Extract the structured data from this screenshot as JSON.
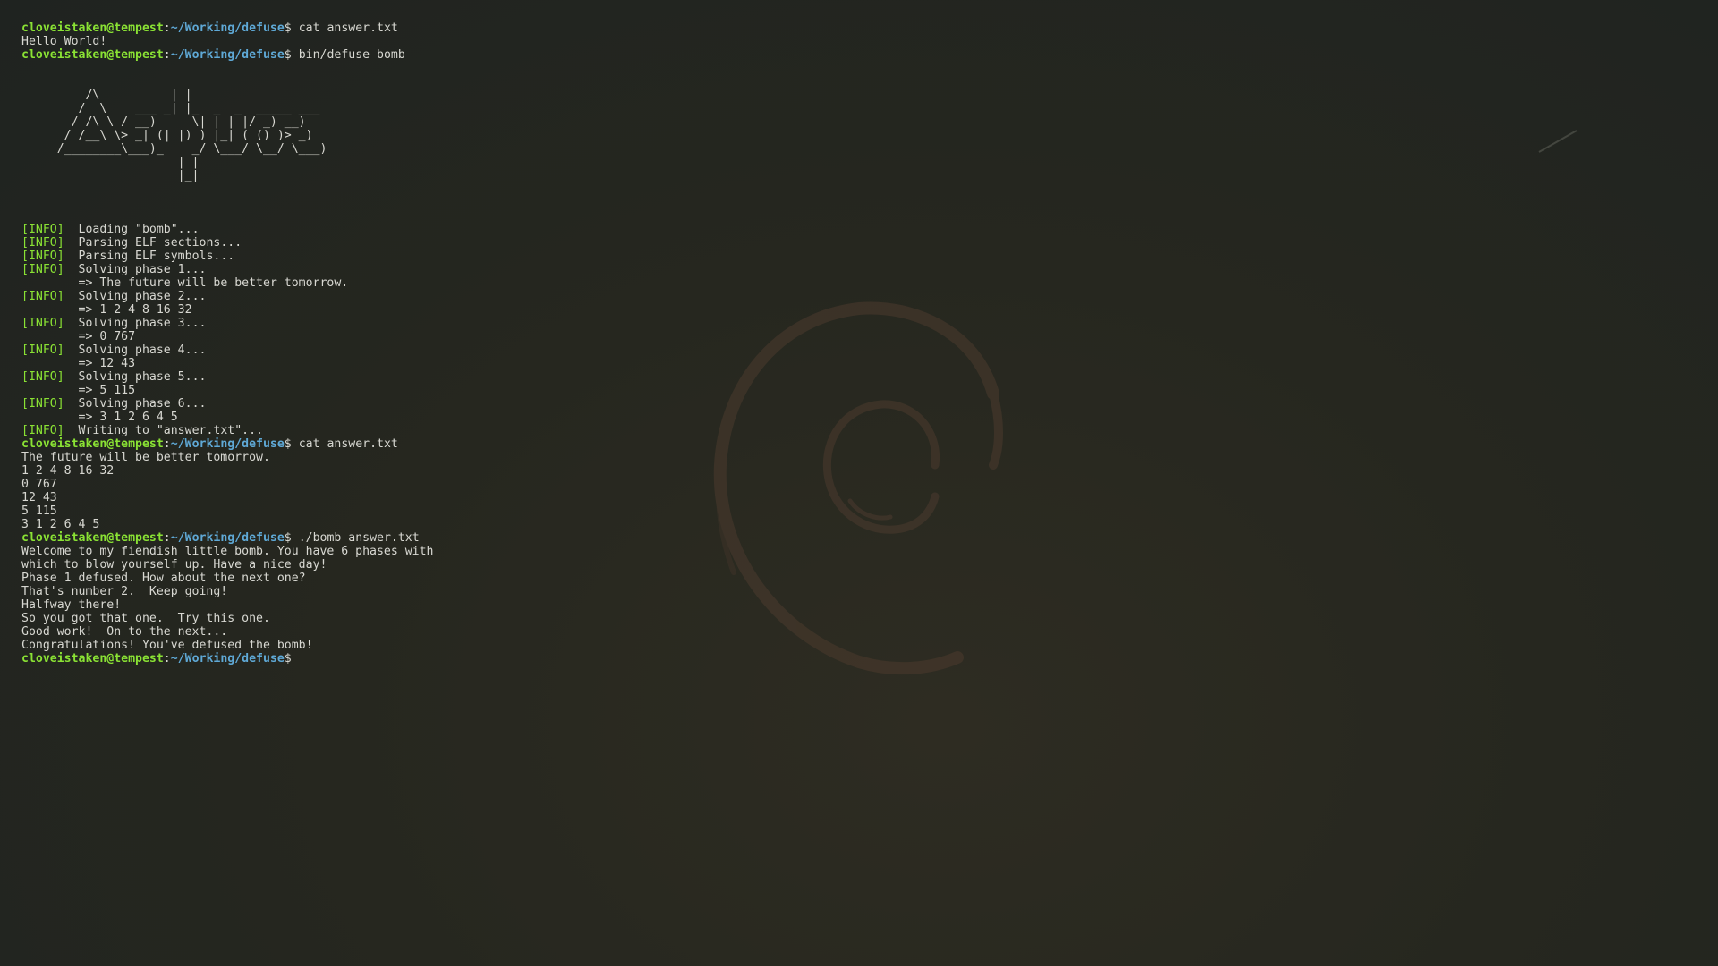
{
  "terminal": {
    "prompt": {
      "user_host": "cloveistaken@tempest",
      "colon": ":",
      "cwd": "~/Working/defuse",
      "symbol": "$"
    },
    "session": {
      "cmd1": "cat answer.txt",
      "cmd1_output": "Hello World!",
      "cmd2": "bin/defuse bomb",
      "banner": [
        "         /\\          | |",
        "        /  \\    ___ _| |_  _  _  _____ ___",
        "       / /\\ \\ / __)     \\| | | |/ _) __)",
        "      / /__\\ \\> _| (| |) ) |_| ( () )> _)",
        "     /________\\___)_    _/ \\___/ \\__/ \\___)",
        "                      | |",
        "                      |_|"
      ],
      "log_tag": "[INFO]",
      "log": [
        {
          "msg": "Loading \"bomb\"...",
          "result": ""
        },
        {
          "msg": "Parsing ELF sections...",
          "result": ""
        },
        {
          "msg": "Parsing ELF symbols...",
          "result": ""
        },
        {
          "msg": "Solving phase 1...",
          "result": "=> The future will be better tomorrow."
        },
        {
          "msg": "Solving phase 2...",
          "result": "=> 1 2 4 8 16 32"
        },
        {
          "msg": "Solving phase 3...",
          "result": "=> 0 767"
        },
        {
          "msg": "Solving phase 4...",
          "result": "=> 12 43"
        },
        {
          "msg": "Solving phase 5...",
          "result": "=> 5 115"
        },
        {
          "msg": "Solving phase 6...",
          "result": "=> 3 1 2 6 4 5"
        },
        {
          "msg": "Writing to \"answer.txt\"...",
          "result": ""
        }
      ],
      "cmd3": "cat answer.txt",
      "cmd3_output": [
        "The future will be better tomorrow.",
        "1 2 4 8 16 32",
        "0 767",
        "12 43",
        "5 115",
        "3 1 2 6 4 5"
      ],
      "cmd4": "./bomb answer.txt",
      "cmd4_output": [
        "Welcome to my fiendish little bomb. You have 6 phases with",
        "which to blow yourself up. Have a nice day!",
        "Phase 1 defused. How about the next one?",
        "That's number 2.  Keep going!",
        "Halfway there!",
        "So you got that one.  Try this one.",
        "Good work!  On to the next...",
        "Congratulations! You've defused the bomb!"
      ]
    }
  },
  "colors": {
    "prompt_user": "#8ae234",
    "prompt_path": "#5fa9d6",
    "text": "#d8d8d2",
    "background": "#23261f",
    "wallpaper_logo": "#4a3a2c"
  },
  "wallpaper": {
    "icon": "debian-swirl-icon"
  }
}
